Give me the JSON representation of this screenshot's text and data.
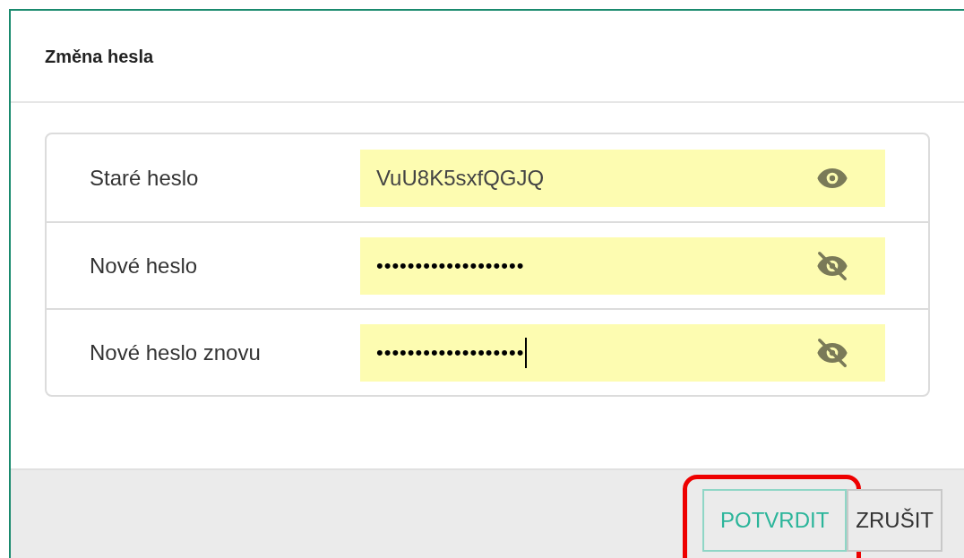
{
  "dialog": {
    "title": "Změna hesla"
  },
  "fields": [
    {
      "label": "Staré heslo",
      "value": "VuU8K5sxfQGJQ",
      "revealed": true,
      "focused": false
    },
    {
      "label": "Nové heslo",
      "value": "•••••••••••••••••••",
      "revealed": false,
      "focused": false
    },
    {
      "label": "Nové heslo znovu",
      "value": "•••••••••••••••••••",
      "revealed": false,
      "focused": true
    }
  ],
  "buttons": [
    {
      "label": "POTVRDIT",
      "kind": "primary",
      "highlighted": true
    },
    {
      "label": "ZRUŠIT",
      "kind": "secondary",
      "highlighted": false
    }
  ]
}
